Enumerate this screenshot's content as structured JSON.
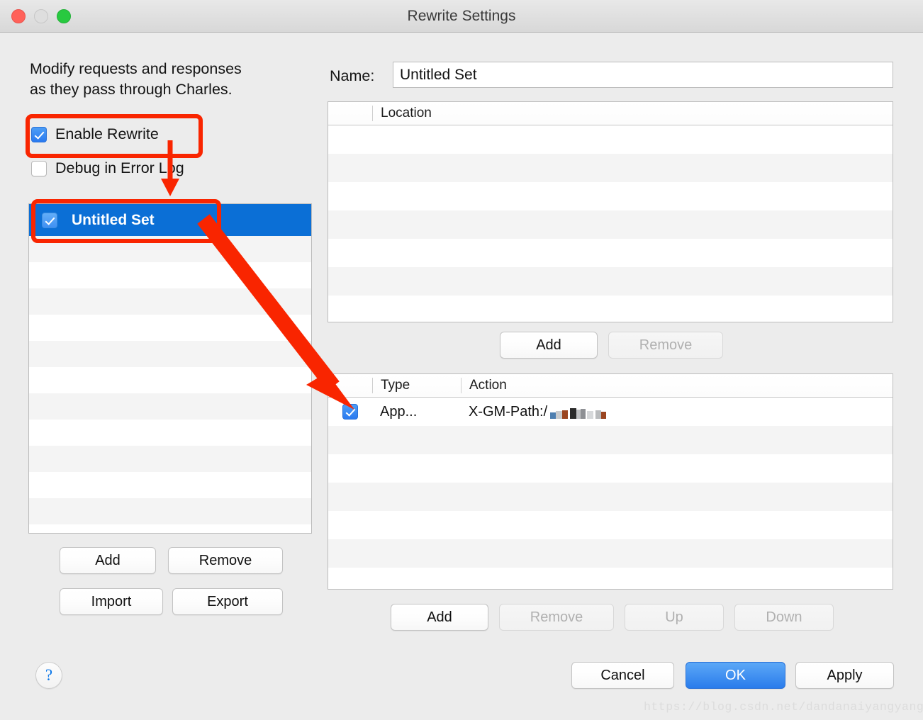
{
  "window": {
    "title": "Rewrite Settings",
    "traffic_lights": [
      "close-red",
      "minimize-gray",
      "zoom-green"
    ]
  },
  "left_panel": {
    "description": "Modify requests and responses\nas they pass through Charles.",
    "enable_rewrite": {
      "label": "Enable Rewrite",
      "checked": true
    },
    "debug_error_log": {
      "label": "Debug in Error Log",
      "checked": false
    },
    "set_list": {
      "selected_item": {
        "label": "Untitled Set",
        "checked": true
      },
      "empty_rows": 11
    },
    "buttons": {
      "add": "Add",
      "remove": "Remove",
      "import": "Import",
      "export": "Export"
    }
  },
  "right_panel": {
    "name_label": "Name:",
    "name_value": "Untitled Set",
    "location_table": {
      "columns": [
        "",
        "Location"
      ],
      "rows": [],
      "empty_rows": 8
    },
    "location_buttons": {
      "add": "Add",
      "remove": "Remove",
      "remove_disabled": true
    },
    "rules_table": {
      "columns": [
        "",
        "Type",
        "Action"
      ],
      "rows": [
        {
          "checked": true,
          "type": "App...",
          "action": "X-GM-Path:/",
          "action_redacted": true
        }
      ],
      "empty_rows": 6
    },
    "rules_buttons": {
      "add": "Add",
      "remove": "Remove",
      "up": "Up",
      "down": "Down",
      "remove_disabled": true,
      "up_disabled": true,
      "down_disabled": true
    }
  },
  "footer": {
    "help": "?",
    "cancel": "Cancel",
    "ok": "OK",
    "apply": "Apply"
  },
  "watermark": "https://blog.csdn.net/dandanaiyangyang",
  "annotation": {
    "color": "#f92500",
    "highlight_enable_rewrite": true,
    "highlight_untitled_set": true,
    "arrow_to_set": true,
    "arrow_to_rule": true
  }
}
